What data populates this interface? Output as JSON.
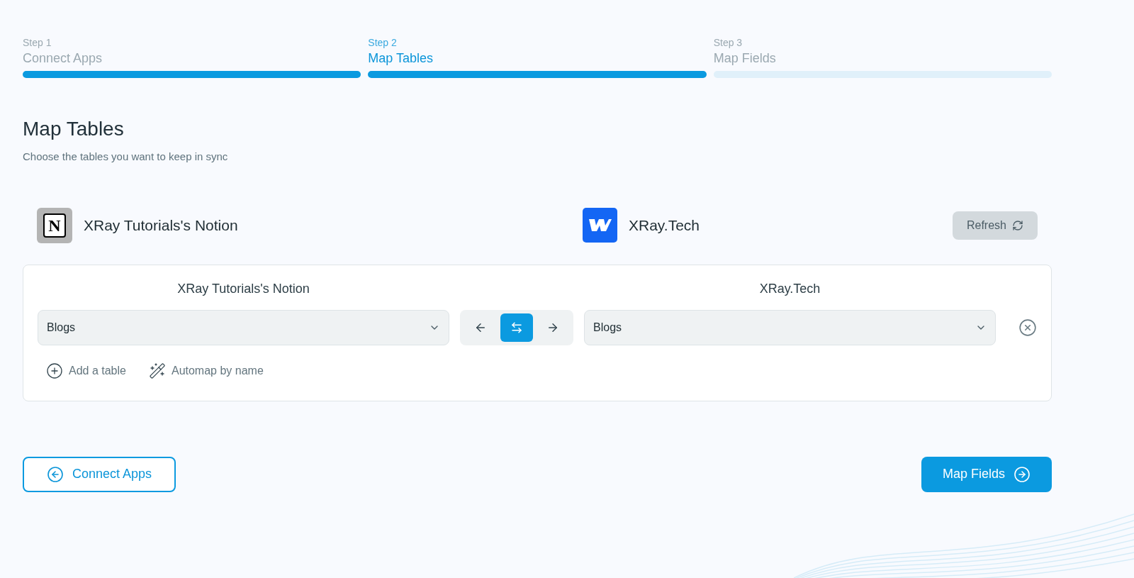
{
  "steps": [
    {
      "number": "Step 1",
      "label": "Connect Apps",
      "selected": false,
      "complete": true
    },
    {
      "number": "Step 2",
      "label": "Map Tables",
      "selected": true,
      "complete": true
    },
    {
      "number": "Step 3",
      "label": "Map Fields",
      "selected": false,
      "complete": false
    }
  ],
  "heading": {
    "title": "Map Tables",
    "subtitle": "Choose the tables you want to keep in sync"
  },
  "apps": {
    "source": {
      "name": "XRay Tutorials's Notion",
      "logo": "N"
    },
    "target": {
      "name": "XRay.Tech"
    },
    "refresh_button": "Refresh"
  },
  "mapping": {
    "source_header": "XRay Tutorials's Notion",
    "target_header": "XRay.Tech",
    "rows": [
      {
        "source_table": "Blogs",
        "target_table": "Blogs",
        "directions": [
          {
            "kind": "left",
            "selected": false
          },
          {
            "kind": "both",
            "selected": true
          },
          {
            "kind": "right",
            "selected": false
          }
        ]
      }
    ],
    "actions": [
      {
        "kind": "add",
        "label": "Add a table"
      },
      {
        "kind": "automap",
        "label": "Automap by name"
      }
    ]
  },
  "footer": {
    "back_button": "Connect Apps",
    "next_button": "Map Fields"
  }
}
